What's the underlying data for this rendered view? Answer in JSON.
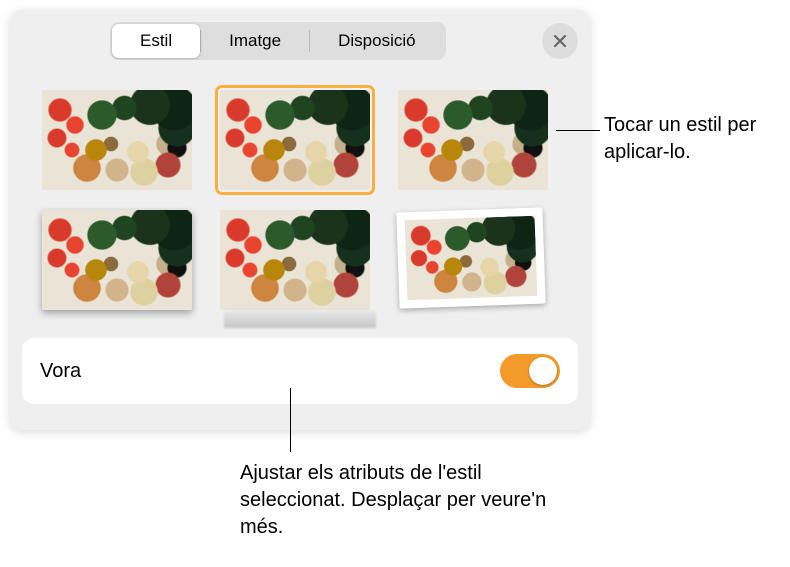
{
  "tabs": {
    "style": "Estil",
    "image": "Imatge",
    "layout": "Disposició",
    "active_index": 0
  },
  "section": {
    "border_label": "Vora",
    "border_on": true
  },
  "callouts": {
    "top": "Tocar un estil per aplicar-lo.",
    "bottom": "Ajustar els atributs de l'estil seleccionat. Desplaçar per veure'n més."
  },
  "styles": {
    "count": 6,
    "selected_index": 1
  },
  "colors": {
    "accent": "#f39a2a"
  }
}
